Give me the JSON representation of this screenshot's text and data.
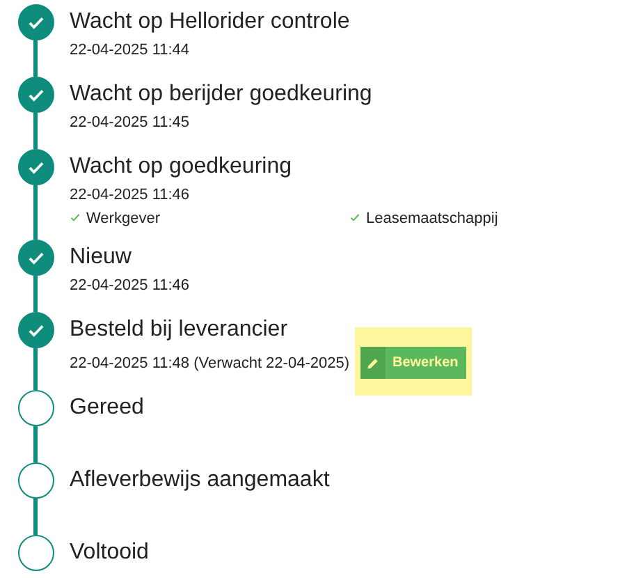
{
  "steps": [
    {
      "title": "Wacht op Hellorider controle",
      "date": "22-04-2025 11:44",
      "done": true
    },
    {
      "title": "Wacht op berijder goedkeuring",
      "date": "22-04-2025 11:45",
      "done": true
    },
    {
      "title": "Wacht op goedkeuring",
      "date": "22-04-2025 11:46",
      "done": true,
      "approvals": [
        {
          "label": "Werkgever",
          "checked": true
        },
        {
          "label": "Leasemaatschappij",
          "checked": true
        }
      ]
    },
    {
      "title": "Nieuw",
      "date": "22-04-2025 11:46",
      "done": true
    },
    {
      "title": "Besteld bij leverancier",
      "date": "22-04-2025 11:48 (Verwacht 22-04-2025)",
      "done": true,
      "action": {
        "label": "Bewerken",
        "highlighted": true
      }
    },
    {
      "title": "Gereed",
      "done": false
    },
    {
      "title": "Afleverbewijs aangemaakt",
      "done": false
    },
    {
      "title": "Voltooid",
      "done": false
    }
  ]
}
